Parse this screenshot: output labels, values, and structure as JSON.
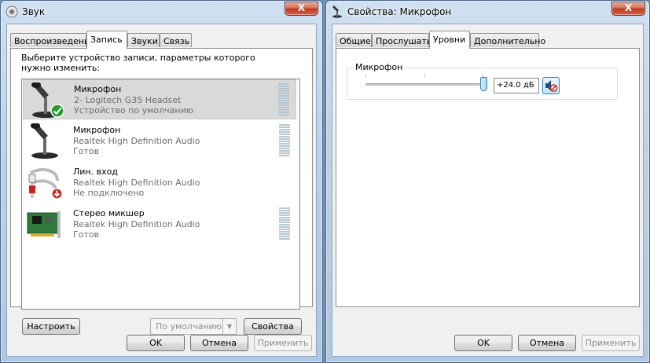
{
  "window1": {
    "title": "Звук",
    "close_label": "X",
    "tabs": [
      {
        "label": "Воспроизведение",
        "active": false
      },
      {
        "label": "Запись",
        "active": true
      },
      {
        "label": "Звуки",
        "active": false
      },
      {
        "label": "Связь",
        "active": false
      }
    ],
    "instruction": "Выберите устройство записи, параметры которого нужно изменить:",
    "devices": [
      {
        "name": "Микрофон",
        "driver": "2- Logitech G35 Headset",
        "status": "Устройство по умолчанию",
        "selected": true,
        "icon": "microphone-icon",
        "badge": "default-checkmark-icon"
      },
      {
        "name": "Микрофон",
        "driver": "Realtek High Definition Audio",
        "status": "Готов",
        "selected": false,
        "icon": "microphone-icon"
      },
      {
        "name": "Лин. вход",
        "driver": "Realtek High Definition Audio",
        "status": "Не подключено",
        "selected": false,
        "icon": "line-in-cable-icon",
        "badge": "unplugged-arrow-icon"
      },
      {
        "name": "Стерео микшер",
        "driver": "Realtek High Definition Audio",
        "status": "Готов",
        "selected": false,
        "icon": "sound-card-icon"
      }
    ],
    "buttons": {
      "configure": "Настроить",
      "set_default": "По умолчанию",
      "properties": "Свойства",
      "ok": "OK",
      "cancel": "Отмена",
      "apply": "Применить"
    }
  },
  "window2": {
    "title": "Свойства: Микрофон",
    "close_label": "X",
    "tabs": [
      {
        "label": "Общие",
        "active": false
      },
      {
        "label": "Прослушать",
        "active": false
      },
      {
        "label": "Уровни",
        "active": true
      },
      {
        "label": "Дополнительно",
        "active": false
      }
    ],
    "levels": {
      "group_label": "Микрофон",
      "level_text": "+24.0 дБ",
      "slider_fraction": 1.0,
      "muted": true
    },
    "buttons": {
      "ok": "OK",
      "cancel": "Отмена",
      "apply": "Применить"
    }
  },
  "colors": {
    "accent_blue": "#3c7fb1",
    "default_check_green": "#1f9d2b",
    "unplugged_red": "#c8261a",
    "meter_idle": "#b7c6d1"
  }
}
